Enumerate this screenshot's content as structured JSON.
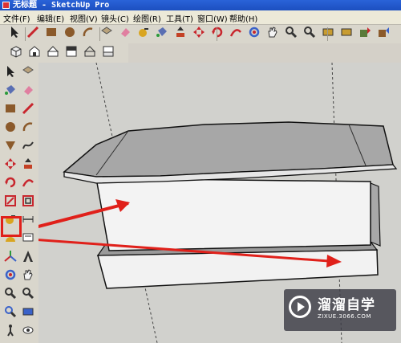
{
  "window": {
    "title": "无标题 - SketchUp Pro"
  },
  "menu": [
    "文件(F)",
    "编辑(E)",
    "视图(V)",
    "镜头(C)",
    "绘图(R)",
    "工具(T)",
    "窗口(W)",
    "帮助(H)"
  ],
  "toolbar_main": [
    {
      "name": "select-arrow-icon",
      "color": "#222222"
    },
    {
      "name": "line-pencil-icon",
      "color": "#c8262d"
    },
    {
      "name": "rectangle-icon",
      "color": "#8b5a2b"
    },
    {
      "name": "circle-icon",
      "color": "#8b5a2b"
    },
    {
      "name": "arc-icon",
      "color": "#8b5a2b"
    },
    {
      "name": "make-component-icon",
      "color": "#b9a27b"
    },
    {
      "name": "eraser-icon",
      "color": "#e07fa0"
    },
    {
      "name": "tape-measure-icon",
      "color": "#d9a520"
    },
    {
      "name": "paint-bucket-icon",
      "color": "#5a6fb3"
    },
    {
      "name": "push-pull-icon",
      "color": "#c44125"
    },
    {
      "name": "move-icon",
      "color": "#c8262d"
    },
    {
      "name": "rotate-icon",
      "color": "#c8262d"
    },
    {
      "name": "follow-me-icon",
      "color": "#c8262d"
    },
    {
      "name": "orbit-icon",
      "color": "#3a62c9"
    },
    {
      "name": "pan-hand-icon",
      "color": "#d6d6d6"
    },
    {
      "name": "zoom-icon",
      "color": "#333333"
    },
    {
      "name": "zoom-extents-icon",
      "color": "#333333"
    },
    {
      "name": "previous-view-icon",
      "color": "#c89c30"
    },
    {
      "name": "next-view-icon",
      "color": "#c89c30"
    },
    {
      "name": "get-models-icon",
      "color": "#5a7a3a"
    },
    {
      "name": "share-model-icon",
      "color": "#3a62c9"
    }
  ],
  "toolbar_views": [
    {
      "name": "iso-view-icon"
    },
    {
      "name": "top-view-icon"
    },
    {
      "name": "front-view-icon"
    },
    {
      "name": "right-view-icon"
    },
    {
      "name": "back-view-icon"
    },
    {
      "name": "left-view-icon"
    }
  ],
  "toolbar_left": [
    {
      "name": "select-arrow-icon",
      "color": "#222222"
    },
    {
      "name": "make-component-icon",
      "color": "#b9a27b"
    },
    {
      "name": "paint-bucket-icon",
      "color": "#5a6fb3"
    },
    {
      "name": "eraser-icon",
      "color": "#e07fa0"
    },
    {
      "name": "rectangle-icon",
      "color": "#8b5a2b"
    },
    {
      "name": "line-pencil-icon",
      "color": "#c8262d"
    },
    {
      "name": "circle-icon",
      "color": "#8b5a2b"
    },
    {
      "name": "arc-icon",
      "color": "#8b5a2b"
    },
    {
      "name": "polygon-icon",
      "color": "#8b5a2b"
    },
    {
      "name": "freehand-icon",
      "color": "#333333"
    },
    {
      "name": "move-icon",
      "color": "#c8262d"
    },
    {
      "name": "push-pull-icon",
      "color": "#c44125"
    },
    {
      "name": "rotate-icon",
      "color": "#c8262d"
    },
    {
      "name": "follow-me-icon",
      "color": "#c8262d"
    },
    {
      "name": "scale-icon",
      "color": "#c8262d"
    },
    {
      "name": "offset-icon",
      "color": "#c8262d"
    },
    {
      "name": "tape-measure-icon",
      "color": "#d9a520"
    },
    {
      "name": "dimension-icon",
      "color": "#333333"
    },
    {
      "name": "protractor-icon",
      "color": "#d9a520"
    },
    {
      "name": "text-icon",
      "color": "#333333"
    },
    {
      "name": "axes-icon",
      "color": "#3a62c9"
    },
    {
      "name": "3d-text-icon",
      "color": "#333333"
    },
    {
      "name": "orbit-icon",
      "color": "#3a62c9"
    },
    {
      "name": "pan-hand-icon",
      "color": "#d6d6d6"
    },
    {
      "name": "zoom-icon",
      "color": "#333333"
    },
    {
      "name": "zoom-window-icon",
      "color": "#333333"
    },
    {
      "name": "zoom-extents-icon",
      "color": "#3a62c9"
    },
    {
      "name": "previous-view-icon",
      "color": "#3a62c9"
    },
    {
      "name": "walk-icon",
      "color": "#333333"
    },
    {
      "name": "look-around-icon",
      "color": "#333333"
    }
  ],
  "colors": {
    "highlight_box": "#e0201a",
    "arrow": "#e0201a",
    "canvas_bg": "#d1d1cd"
  },
  "watermark": {
    "name": "溜溜自学",
    "url": "ZIXUE.3066.COM"
  }
}
